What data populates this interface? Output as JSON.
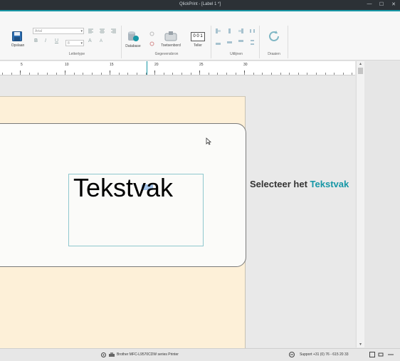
{
  "window": {
    "title": "QlickPrint - [Label 1 *]",
    "minimize": "—",
    "maximize": "☐",
    "close": "✕"
  },
  "ribbon": {
    "save_label": "Opslaan",
    "font_name": "Arial",
    "font_size": "8",
    "group_font": "Lettertype",
    "database_label": "Database",
    "keyboard_label": "Toetsenbord",
    "counter_label": "Teller",
    "counter_value": "0 0 1",
    "group_data": "Gegevensbron",
    "group_align": "Uitlijnen",
    "group_rotate": "Draaien",
    "bold": "B",
    "italic": "I",
    "underline": "U",
    "grow_font": "A",
    "shrink_font": "A"
  },
  "ruler": {
    "labels": [
      "5",
      "10",
      "15",
      "20",
      "25",
      "30"
    ]
  },
  "canvas": {
    "textbox_text": "Tekstvak"
  },
  "instruction": {
    "prefix": "Selecteer het ",
    "highlight": "Tekstvak"
  },
  "status": {
    "printer": "Brother MFC-L9570CDW series Printer",
    "support": "Support +31 (0) 76 - 615 20 33"
  },
  "colors": {
    "accent": "#1797a6",
    "label_bg": "#fdf0d8",
    "titlebar": "#2c3136"
  }
}
